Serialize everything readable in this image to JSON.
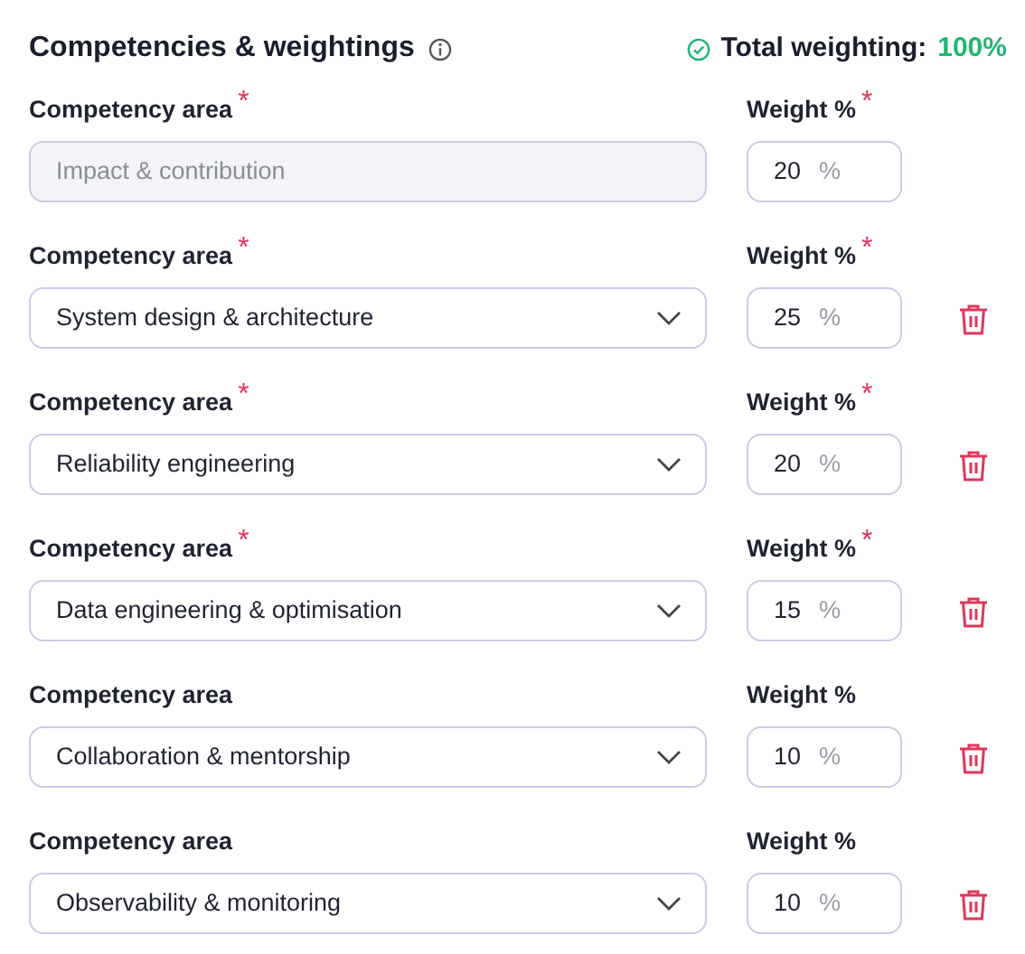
{
  "header": {
    "title": "Competencies & weightings",
    "total_label": "Total weighting:",
    "total_value": "100%",
    "valid": true
  },
  "required_marker": "*",
  "rows": [
    {
      "area_label": "Competency area",
      "area_required": true,
      "area_value": "Impact & contribution",
      "disabled": true,
      "weight_label": "Weight %",
      "weight_required": true,
      "weight": "20",
      "unit": "%",
      "removable": false
    },
    {
      "area_label": "Competency area",
      "area_required": true,
      "area_value": "System design & architecture",
      "disabled": false,
      "weight_label": "Weight %",
      "weight_required": true,
      "weight": "25",
      "unit": "%",
      "removable": true
    },
    {
      "area_label": "Competency area",
      "area_required": true,
      "area_value": "Reliability engineering",
      "disabled": false,
      "weight_label": "Weight %",
      "weight_required": true,
      "weight": "20",
      "unit": "%",
      "removable": true
    },
    {
      "area_label": "Competency area",
      "area_required": true,
      "area_value": "Data engineering & optimisation",
      "disabled": false,
      "weight_label": "Weight %",
      "weight_required": true,
      "weight": "15",
      "unit": "%",
      "removable": true
    },
    {
      "area_label": "Competency area",
      "area_required": false,
      "area_value": "Collaboration & mentorship",
      "disabled": false,
      "weight_label": "Weight %",
      "weight_required": false,
      "weight": "10",
      "unit": "%",
      "removable": true
    },
    {
      "area_label": "Competency area",
      "area_required": false,
      "area_value": "Observability & monitoring",
      "disabled": false,
      "weight_label": "Weight %",
      "weight_required": false,
      "weight": "10",
      "unit": "%",
      "removable": true
    }
  ]
}
